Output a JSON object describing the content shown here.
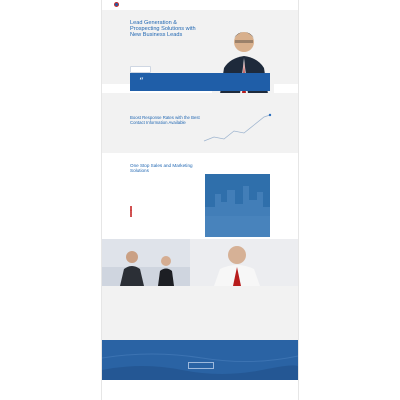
{
  "header": {
    "logo_text": "",
    "nav": []
  },
  "hero": {
    "title": "Lead Generation & Prospecting Solutions with New Business Leads",
    "body": "",
    "button": ""
  },
  "quote": {
    "text": ""
  },
  "section2": {
    "title": "Boost Response Rates with the Best Contact Information Available",
    "body": "",
    "chart_label": ""
  },
  "section3": {
    "title": "One Stop Sales and Marketing Solutions",
    "body": "",
    "list": [],
    "image_text": ""
  },
  "section5": {
    "left_title": "",
    "left_body": "",
    "right_title": "",
    "right_body": ""
  },
  "cta": {
    "text": "",
    "button": ""
  },
  "footer": {
    "text": ""
  },
  "colors": {
    "brand_blue": "#1f66b2",
    "accent_red": "#c62828",
    "panel_gray": "#f2f2f2",
    "quote_blue": "#1f5ea8"
  },
  "icons": {
    "logo": "logo-icon",
    "quote": "quote-icon",
    "bullet": "bullet-icon"
  }
}
